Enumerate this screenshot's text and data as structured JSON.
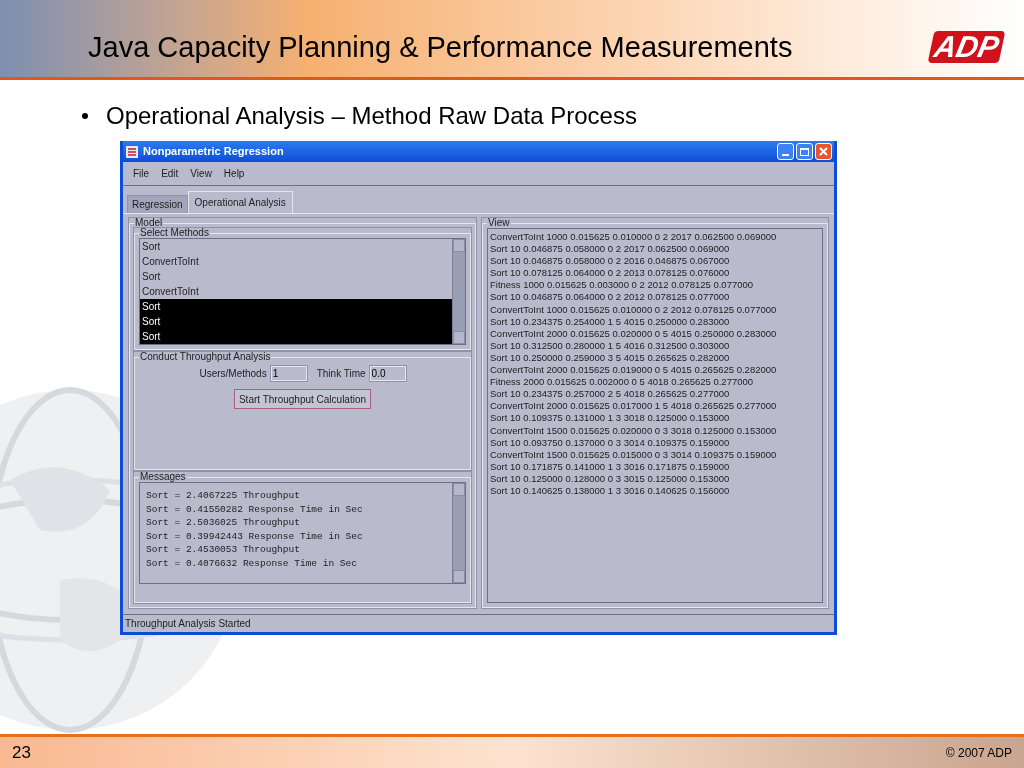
{
  "slide": {
    "title": "Java Capacity Planning & Performance Measurements",
    "logo": "ADP",
    "bullet": "Operational Analysis – Method Raw Data Process",
    "page_number": "23",
    "footer": "© 2007 ADP"
  },
  "window": {
    "title": "Nonparametric Regression",
    "menu": [
      "File",
      "Edit",
      "View",
      "Help"
    ],
    "tabs": [
      {
        "label": "Regression",
        "selected": false
      },
      {
        "label": "Operational Analysis",
        "selected": true
      }
    ],
    "model": {
      "title": "Model",
      "methods": {
        "title": "Select Methods",
        "items": [
          {
            "label": "Sort",
            "selected": false
          },
          {
            "label": "ConvertToInt",
            "selected": false
          },
          {
            "label": "Sort",
            "selected": false
          },
          {
            "label": "ConvertToInt",
            "selected": false
          },
          {
            "label": "Sort",
            "selected": true
          },
          {
            "label": "Sort",
            "selected": true
          },
          {
            "label": "Sort",
            "selected": true
          }
        ]
      },
      "throughput": {
        "title": "Conduct Throughput Analysis",
        "users_label": "Users/Methods",
        "users_value": "1",
        "think_label": "Think Time",
        "think_value": "0.0",
        "button": "Start Throughput Calculation"
      },
      "messages": {
        "title": "Messages",
        "lines": [
          "Sort = 2.4067225 Throughput",
          "Sort = 0.41550282 Response Time in Sec",
          "Sort = 2.5036025 Throughput",
          "Sort = 0.39942443 Response Time in Sec",
          "Sort = 2.4530053 Throughput",
          "Sort = 0.4076632 Response Time in Sec"
        ]
      }
    },
    "view": {
      "title": "View",
      "lines": [
        "ConvertToInt 1000 0.015625 0.010000 0 2 2017 0.062500 0.069000",
        "Sort 10 0.046875 0.058000 0 2 2017 0.062500 0.069000",
        "Sort 10 0.046875 0.058000 0 2 2016 0.046875 0.067000",
        "Sort 10 0.078125 0.064000 0 2 2013 0.078125 0.076000",
        "Fitness 1000 0.015625 0.003000 0 2 2012 0.078125 0.077000",
        "Sort 10 0.046875 0.064000 0 2 2012 0.078125 0.077000",
        "ConvertToInt 1000 0.015625 0.010000 0 2 2012 0.078125 0.077000",
        "Sort 10 0.234375 0.254000 1 5 4015 0.250000 0.283000",
        "ConvertToInt 2000 0.015625 0.020000 0 5 4015 0.250000 0.283000",
        "Sort 10 0.312500 0.280000 1 5 4016 0.312500 0.303000",
        "Sort 10 0.250000 0.259000 3 5 4015 0.265625 0.282000",
        "ConvertToInt 2000 0.015625 0.019000 0 5 4015 0.265625 0.282000",
        "Fitness 2000 0.015625 0.002000 0 5 4018 0.265625 0.277000",
        "Sort 10 0.234375 0.257000 2 5 4018 0.265625 0.277000",
        "ConvertToInt 2000 0.015625 0.017000 1 5 4018 0.265625 0.277000",
        "Sort 10 0.109375 0.131000 1 3 3018 0.125000 0.153000",
        "ConvertToInt 1500 0.015625 0.020000 0 3 3018 0.125000 0.153000",
        "Sort 10 0.093750 0.137000 0 3 3014 0.109375 0.159000",
        "ConvertToInt 1500 0.015625 0.015000 0 3 3014 0.109375 0.159000",
        "Sort 10 0.171875 0.141000 1 3 3016 0.171875 0.159000",
        "Sort 10 0.125000 0.128000 0 3 3015 0.125000 0.153000",
        "Sort 10 0.140625 0.138000 1 3 3016 0.140625 0.156000"
      ]
    },
    "status_bar": "Throughput Analysis Started"
  }
}
